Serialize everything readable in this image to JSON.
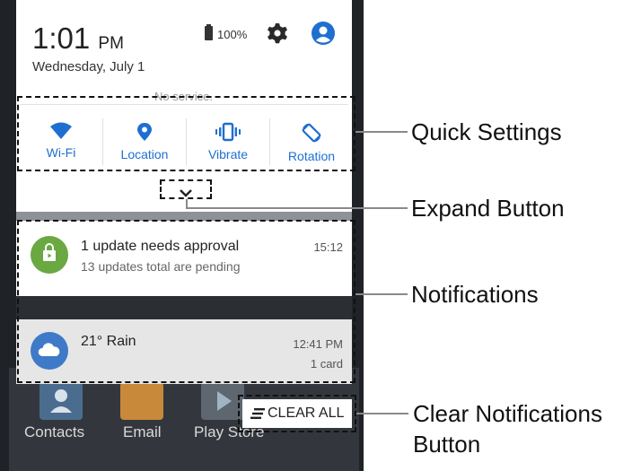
{
  "status_bar": {
    "time": "1:01",
    "ampm": "PM",
    "date": "Wednesday, July 1",
    "battery": "100%",
    "settings_icon": "gear-icon",
    "account_icon": "account-circle-icon"
  },
  "network": {
    "status": "No service."
  },
  "quick_settings": {
    "tiles": [
      {
        "label": "Wi-Fi",
        "icon": "wifi-icon"
      },
      {
        "label": "Location",
        "icon": "location-pin-icon"
      },
      {
        "label": "Vibrate",
        "icon": "vibrate-icon"
      },
      {
        "label": "Rotation",
        "icon": "rotation-icon"
      }
    ],
    "expand_icon": "chevron-down-icon"
  },
  "notifications": [
    {
      "title": "1 update needs approval",
      "subtitle": "13 updates total are pending",
      "time": "15:12",
      "icon": "play-store-bag-icon",
      "color": "#6aa842"
    },
    {
      "title": "21° Rain",
      "time": "12:41 PM",
      "meta": "1 card",
      "icon": "cloud-icon",
      "color": "#3f7ac8"
    }
  ],
  "clear_all": {
    "label": "CLEAR ALL",
    "icon": "clear-all-icon"
  },
  "home_screen": {
    "apps": [
      {
        "label": "Contacts",
        "icon": "contacts-icon"
      },
      {
        "label": "Email",
        "icon": "email-icon"
      },
      {
        "label": "Play Store",
        "icon": "play-store-icon"
      }
    ]
  },
  "callouts": {
    "quick_settings": "Quick Settings",
    "expand_button": "Expand Button",
    "notifications": "Notifications",
    "clear_line1": "Clear Notifications",
    "clear_line2": "Button"
  },
  "colors": {
    "accent": "#1e6fd0",
    "shade": "#ffffff",
    "background": "#3b3f45"
  }
}
